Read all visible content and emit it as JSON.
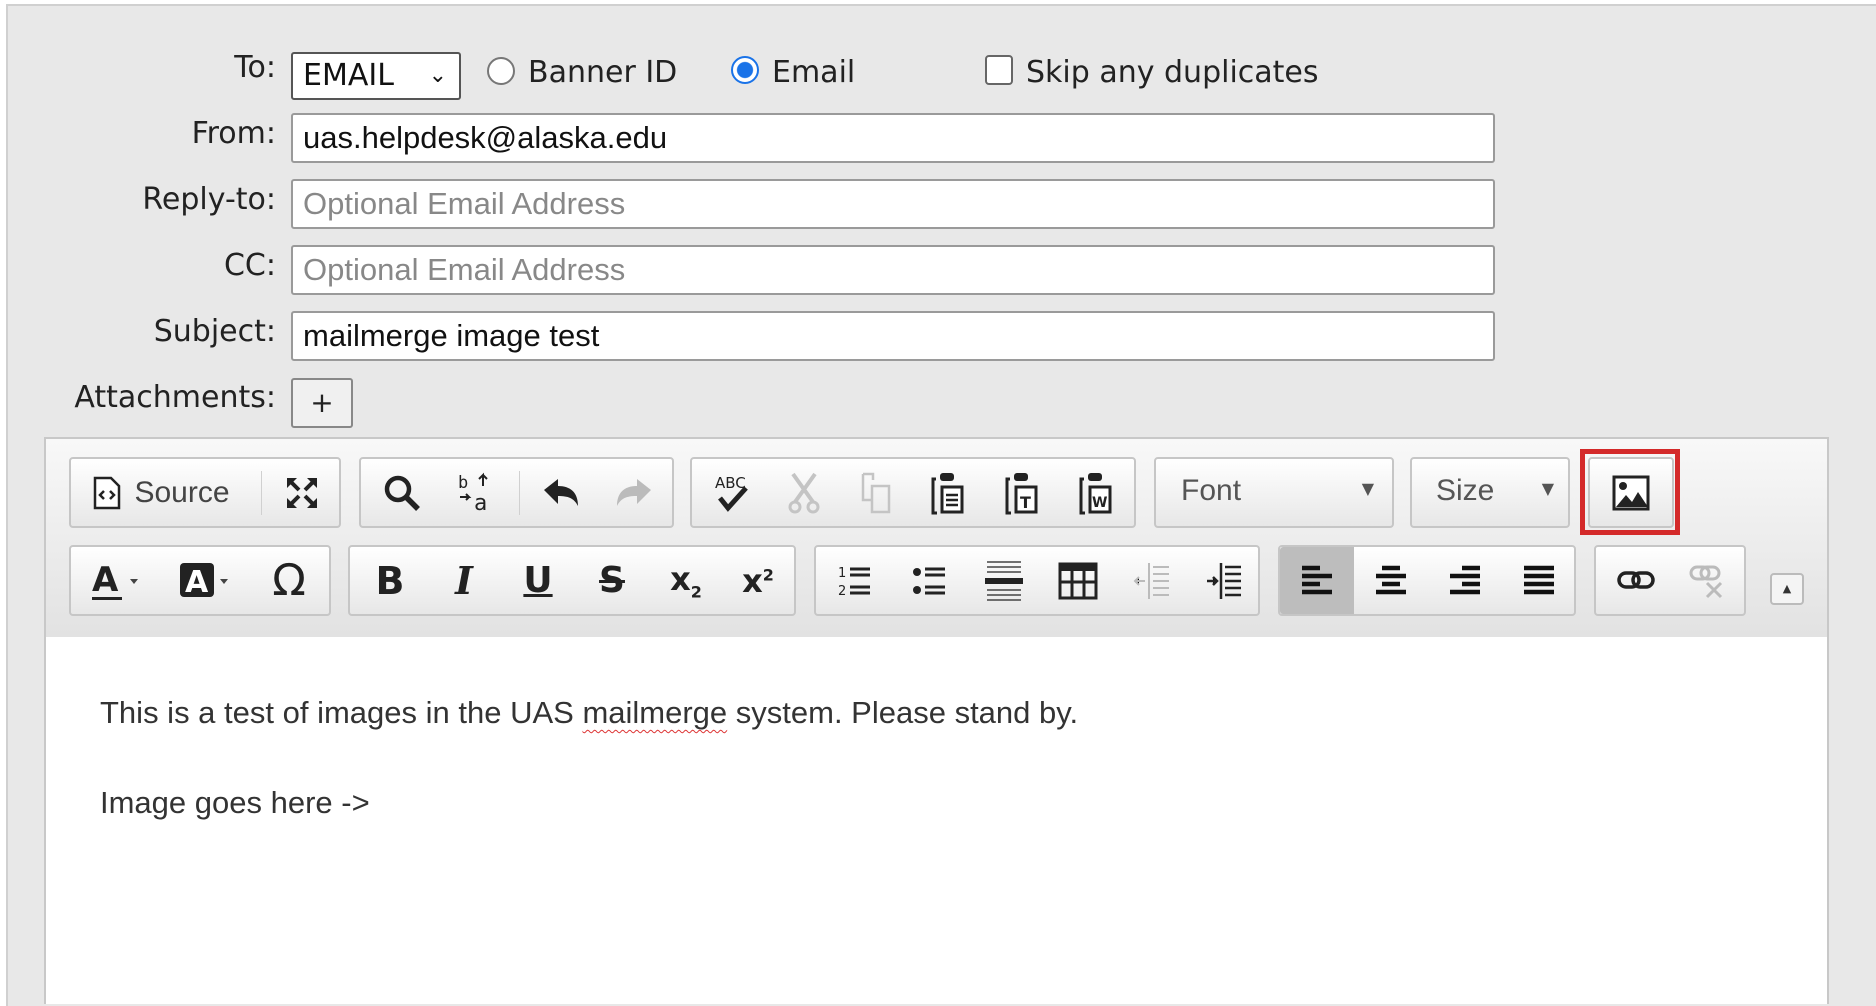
{
  "form": {
    "to_label": "To:",
    "to_select": "EMAIL",
    "radio_banner_label": "Banner ID",
    "radio_email_label": "Email",
    "radio_selected": "Email",
    "skip_dup_label": "Skip any duplicates",
    "skip_dup_checked": false,
    "from_label": "From:",
    "from_value": "uas.helpdesk@alaska.edu",
    "replyto_label": "Reply-to:",
    "replyto_placeholder": "Optional Email Address",
    "cc_label": "CC:",
    "cc_placeholder": "Optional Email Address",
    "subject_label": "Subject:",
    "subject_value": "mailmerge image test",
    "attachments_label": "Attachments:",
    "attach_button": "+"
  },
  "toolbar": {
    "row1": {
      "source_label": "Source",
      "font_label": "Font",
      "size_label": "Size"
    },
    "highlight_color": "#d42a2a",
    "highlighted_button": "image-icon"
  },
  "content": {
    "line1_pre": "This is a test of images in the UAS ",
    "line1_misspelled": "mailmerge",
    "line1_post": " system. Please stand by.",
    "line2": "Image goes here ->"
  }
}
